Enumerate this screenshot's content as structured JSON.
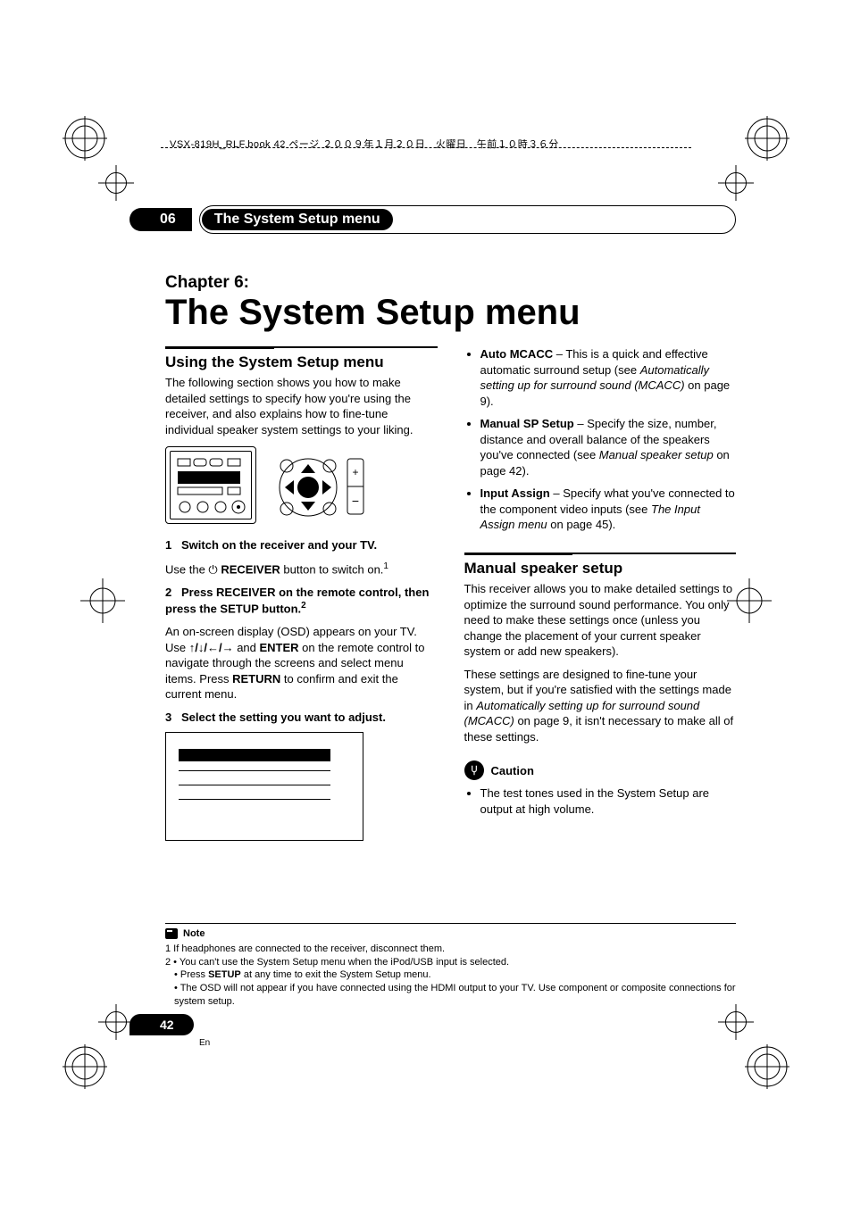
{
  "meta": {
    "book_header": "VSX-819H_RLF.book  42 ページ  ２００９年１月２０日　火曜日　午前１０時３６分"
  },
  "header": {
    "chapter_num": "06",
    "tab_title": "The System Setup menu"
  },
  "chapter": {
    "label": "Chapter 6:",
    "title": "The System Setup menu"
  },
  "section1": {
    "heading": "Using the System Setup menu",
    "intro": "The following section shows you how to make detailed settings to specify how you're using the receiver, and also explains how to fine-tune individual speaker system settings to your liking.",
    "step1_title": "Switch on the receiver and your TV.",
    "step1_body_a": "Use the ",
    "step1_body_b": " RECEIVER",
    "step1_body_c": " button to switch on.",
    "step1_footref": "1",
    "step2_title_a": "Press RECEIVER on the remote control, then press the SETUP button.",
    "step2_footref": "2",
    "step2_body_a": "An on-screen display (OSD) appears on your TV. Use ",
    "step2_arrows": "↑/↓/←/→",
    "step2_body_b": " and ",
    "step2_enter": "ENTER",
    "step2_body_c": " on the remote control to navigate through the screens and select menu items. Press ",
    "step2_return": "RETURN",
    "step2_body_d": " to confirm and exit the current menu.",
    "step3_title": "Select the setting you want to adjust."
  },
  "rightlist": {
    "items": [
      {
        "term": "Auto MCACC",
        "dash": " – ",
        "desc_a": "This is a quick and effective automatic surround setup (see ",
        "ref": "Automatically setting up for surround sound (MCACC)",
        "desc_b": " on page 9)."
      },
      {
        "term": "Manual SP Setup",
        "dash": " – ",
        "desc_a": "Specify the size, number, distance and overall balance of the speakers you've connected (see ",
        "ref": "Manual speaker setup",
        "desc_b": " on page 42)."
      },
      {
        "term": "Input Assign",
        "dash": " – ",
        "desc_a": "Specify what you've connected to the component video inputs (see ",
        "ref": "The Input Assign menu",
        "desc_b": " on page 45)."
      }
    ]
  },
  "section2": {
    "heading": "Manual speaker setup",
    "p1": "This receiver allows you to make detailed settings to optimize the surround sound performance. You only need to make these settings once (unless you change the placement of your current speaker system or add new speakers).",
    "p2_a": "These settings are designed to fine-tune your system, but if you're satisfied with the settings made in ",
    "p2_ref": "Automatically setting up for surround sound (MCACC)",
    "p2_b": " on page 9, it isn't necessary to make all of these settings.",
    "caution_label": "Caution",
    "caution_item": "The test tones used in the System Setup are output at high volume."
  },
  "notes": {
    "label": "Note",
    "n1": "1 If headphones are connected to the receiver, disconnect them.",
    "n2a": "2 • You can't use the System Setup menu when the iPod/USB input is selected.",
    "n2b_a": "• Press ",
    "n2b_setup": "SETUP",
    "n2b_b": " at any time to exit the System Setup menu.",
    "n2c": "• The OSD will not appear if you have connected using the HDMI output to your TV. Use component or composite connections for system setup."
  },
  "pagenum": "42",
  "lang": "En"
}
